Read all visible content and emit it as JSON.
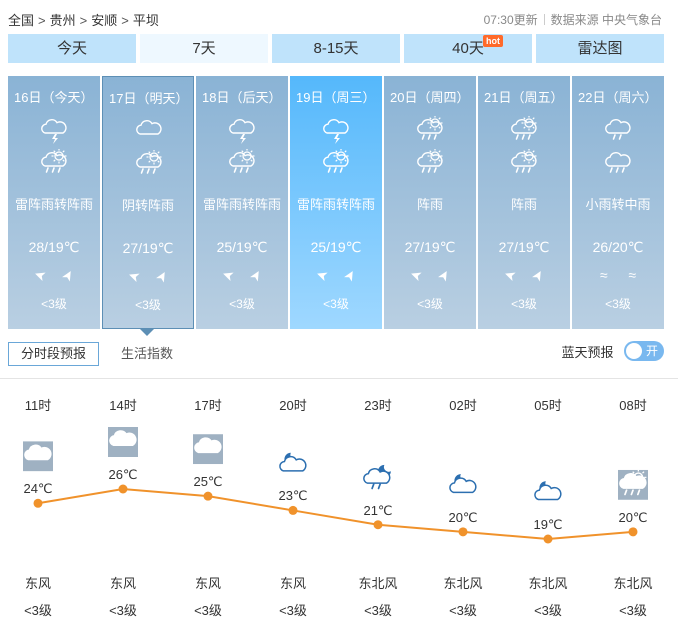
{
  "breadcrumb": [
    "全国",
    "贵州",
    "安顺",
    "平坝"
  ],
  "breadcrumb_sep": ">",
  "update_time": "07:30更新",
  "data_source": "数据来源 中央气象台",
  "tabs": [
    {
      "label": "今天"
    },
    {
      "label": "7天",
      "active": true
    },
    {
      "label": "8-15天"
    },
    {
      "label": "40天",
      "badge": "hot"
    },
    {
      "label": "雷达图"
    }
  ],
  "days": [
    {
      "date": "16日（今天）",
      "desc": "雷阵雨转阵雨",
      "temp": "28/19℃",
      "wind_dir1": "➤",
      "wind_dir2": "➤",
      "level": "<3级",
      "icon1": "thunderstorm-icon",
      "icon2": "shower-icon"
    },
    {
      "date": "17日（明天）",
      "desc": "阴转阵雨",
      "temp": "27/19℃",
      "wind_dir1": "➤",
      "wind_dir2": "➤",
      "level": "<3级",
      "icon1": "overcast-icon",
      "icon2": "shower-icon"
    },
    {
      "date": "18日（后天）",
      "desc": "雷阵雨转阵雨",
      "temp": "25/19℃",
      "wind_dir1": "➤",
      "wind_dir2": "➤",
      "level": "<3级",
      "icon1": "thunderstorm-icon",
      "icon2": "shower-icon"
    },
    {
      "date": "19日（周三）",
      "desc": "雷阵雨转阵雨",
      "temp": "25/19℃",
      "wind_dir1": "➤",
      "wind_dir2": "➤",
      "level": "<3级",
      "icon1": "thunderstorm-icon",
      "icon2": "shower-icon"
    },
    {
      "date": "20日（周四）",
      "desc": "阵雨",
      "temp": "27/19℃",
      "wind_dir1": "➤",
      "wind_dir2": "➤",
      "level": "<3级",
      "icon1": "shower-sun-icon",
      "icon2": "shower-icon"
    },
    {
      "date": "21日（周五）",
      "desc": "阵雨",
      "temp": "27/19℃",
      "wind_dir1": "➤",
      "wind_dir2": "➤",
      "level": "<3级",
      "icon1": "shower-sun-icon",
      "icon2": "shower-icon"
    },
    {
      "date": "22日（周六）",
      "desc": "小雨转中雨",
      "temp": "26/20℃",
      "wind_dir1": "≈",
      "wind_dir2": "≈",
      "level": "<3级",
      "icon1": "light-rain-icon",
      "icon2": "moderate-rain-icon"
    }
  ],
  "subtabs": {
    "active": "分时段预报",
    "other": "生活指数"
  },
  "blue_alert": {
    "label": "蓝天预报",
    "toggle": "开"
  },
  "chart_data": {
    "type": "line",
    "x": [
      "11时",
      "14时",
      "17时",
      "20时",
      "23时",
      "02时",
      "05时",
      "08时"
    ],
    "values": [
      24,
      26,
      25,
      23,
      21,
      20,
      19,
      20
    ],
    "data_labels": [
      "24℃",
      "26℃",
      "25℃",
      "23℃",
      "21℃",
      "20℃",
      "19℃",
      "20℃"
    ],
    "wind": [
      "东风",
      "东风",
      "东风",
      "东风",
      "东北风",
      "东北风",
      "东北风",
      "东北风"
    ],
    "wind_level": [
      "<3级",
      "<3级",
      "<3级",
      "<3级",
      "<3级",
      "<3级",
      "<3级",
      "<3级"
    ],
    "icons": [
      "overcast-icon",
      "overcast-icon",
      "overcast-icon",
      "partly-cloudy-night-icon",
      "shower-night-icon",
      "partly-cloudy-night-icon",
      "partly-cloudy-night-icon",
      "shower-icon"
    ],
    "line_color": "#f0922b"
  },
  "colors": {
    "tab_bg": "#bfe3fb",
    "card_bg": "#8ab3d5",
    "highlight_card": "#55b8fb",
    "accent": "#79b8ef"
  }
}
